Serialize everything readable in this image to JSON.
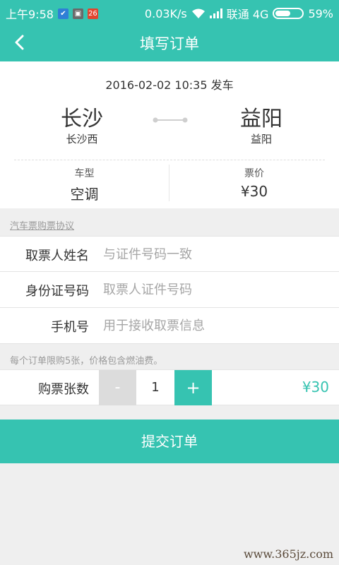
{
  "status_bar": {
    "time": "上午9:58",
    "notif_badge": "26",
    "net_speed": "0.03K/s",
    "carrier": "联通 4G",
    "battery_percent": "59%",
    "battery_level": 0.59
  },
  "header": {
    "title": "填写订单"
  },
  "trip": {
    "departure": "2016-02-02 10:35 发车",
    "from_city": "长沙",
    "from_station": "长沙西",
    "to_city": "益阳",
    "to_station": "益阳",
    "type_label": "车型",
    "type_value": "空调",
    "price_label": "票价",
    "price_value": "¥30"
  },
  "agreement_link": "汽车票购票协议",
  "form": {
    "name_label": "取票人姓名",
    "name_placeholder": "与证件号码一致",
    "id_label": "身份证号码",
    "id_placeholder": "取票人证件号码",
    "phone_label": "手机号",
    "phone_placeholder": "用于接收取票信息"
  },
  "note": "每个订单限购5张，价格包含燃油费。",
  "quantity": {
    "label": "购票张数",
    "minus": "-",
    "count": "1",
    "plus": "+",
    "total": "¥30"
  },
  "submit_label": "提交订单",
  "watermark": "www.365jz.com",
  "colors": {
    "accent": "#36c3b1",
    "bg": "#efefef"
  }
}
